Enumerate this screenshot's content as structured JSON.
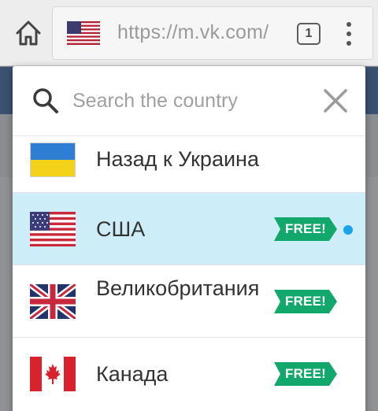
{
  "browser": {
    "url": "https://m.vk.com/",
    "tab_count": "1"
  },
  "search": {
    "placeholder": "Search the country"
  },
  "countries": [
    {
      "label": "Назад к Украина",
      "badge": ""
    },
    {
      "label": "США",
      "badge": "FREE!",
      "selected": true
    },
    {
      "label": "Великобритания",
      "badge": "FREE!"
    },
    {
      "label": "Канада",
      "badge": "FREE!"
    }
  ],
  "colors": {
    "selected_row": "#cdeef9",
    "badge_green": "#13a86b",
    "active_dot": "#1aa3e8"
  }
}
